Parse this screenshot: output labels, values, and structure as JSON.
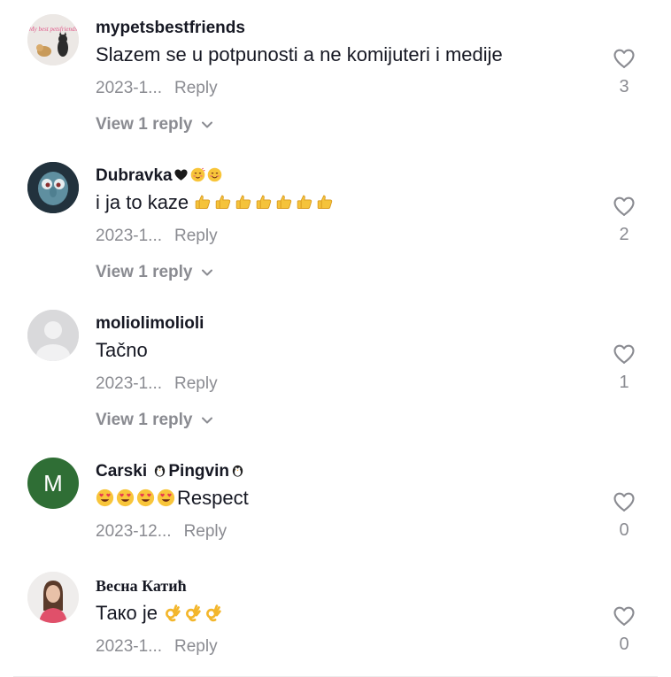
{
  "comments": [
    {
      "username": "mypetsbestfriends",
      "text": "Slazem se u potpunosti a ne komijuteri i medije",
      "date": "2023-1...",
      "reply_label": "Reply",
      "likes": "3",
      "view_replies": "View 1 reply",
      "avatar_text": "My best petsfriends"
    },
    {
      "username": "Dubravka",
      "text": "i ja to kaze",
      "date": "2023-1...",
      "reply_label": "Reply",
      "likes": "2",
      "view_replies": "View 1 reply"
    },
    {
      "username": "moliolimolioli",
      "text": "Tačno",
      "date": "2023-1...",
      "reply_label": "Reply",
      "likes": "1",
      "view_replies": "View 1 reply"
    },
    {
      "username_prefix": "Carski ",
      "username_main": "Pingvin",
      "text": "Respect",
      "date": "2023-12...",
      "reply_label": "Reply",
      "likes": "0",
      "avatar_letter": "M"
    },
    {
      "username": "Весна Катић",
      "text": "Тако је",
      "date": "2023-1...",
      "reply_label": "Reply",
      "likes": "0"
    }
  ],
  "colors": {
    "text": "#161823",
    "muted": "#8a8b91",
    "avatar_green": "#2f6e35",
    "avatar_gray": "#d9d9db"
  },
  "icons": [
    "heart-outline-icon",
    "chevron-down-icon",
    "thumbs-up-emoji",
    "heart-eyes-emoji",
    "ok-hand-emoji",
    "penguin-emoji",
    "black-heart-emoji",
    "smiling-face-emoji",
    "blushing-face-emoji"
  ]
}
